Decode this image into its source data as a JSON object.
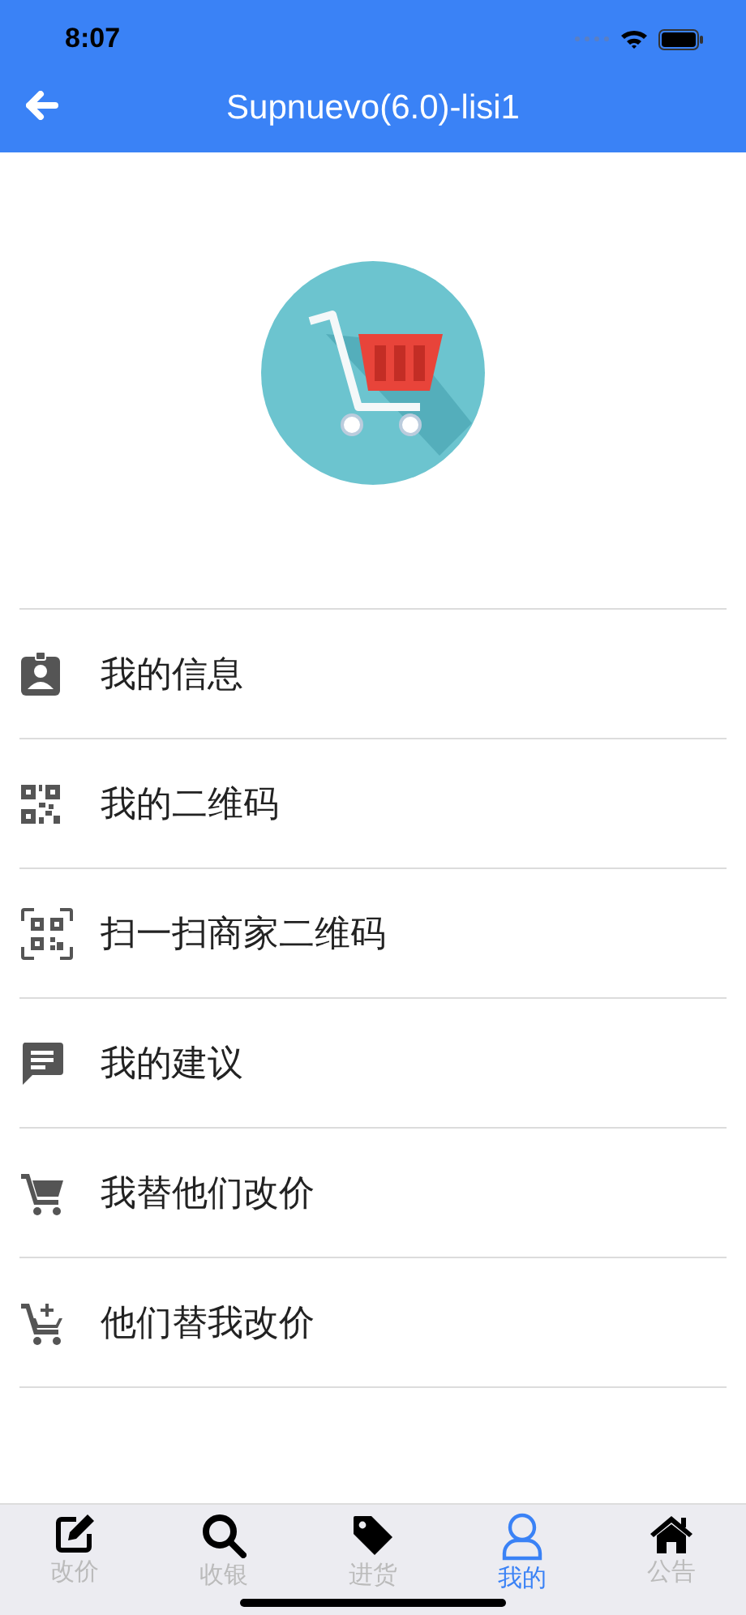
{
  "status_bar": {
    "time": "8:07"
  },
  "header": {
    "title": "Supnuevo(6.0)-lisi1"
  },
  "menu": [
    {
      "kind": "badge",
      "label": "我的信息"
    },
    {
      "kind": "qr",
      "label": "我的二维码"
    },
    {
      "kind": "scan",
      "label": "扫一扫商家二维码"
    },
    {
      "kind": "message",
      "label": "我的建议"
    },
    {
      "kind": "cart",
      "label": "我替他们改价"
    },
    {
      "kind": "cart-add",
      "label": "他们替我改价"
    }
  ],
  "tabs": [
    {
      "kind": "edit",
      "label": "改价",
      "selected": false
    },
    {
      "kind": "search",
      "label": "收银",
      "selected": false
    },
    {
      "kind": "tag",
      "label": "进货",
      "selected": false
    },
    {
      "kind": "user",
      "label": "我的",
      "selected": true
    },
    {
      "kind": "home",
      "label": "公告",
      "selected": false
    }
  ]
}
